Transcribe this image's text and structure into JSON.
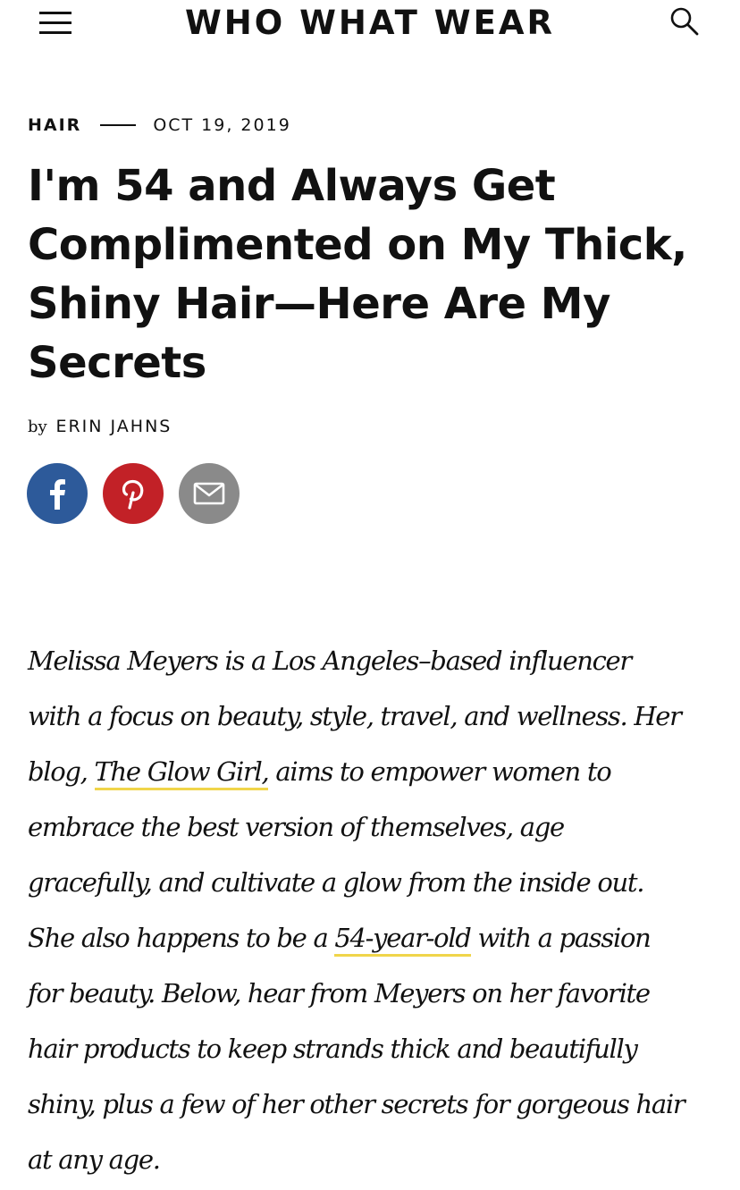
{
  "header": {
    "logo": "WHO WHAT WEAR",
    "menu_icon": "hamburger-menu-icon",
    "search_icon": "search-icon"
  },
  "article": {
    "category": "HAIR",
    "date": "OCT 19, 2019",
    "title": "I'm 54 and Always Get Complimented on My Thick, Shiny Hair—Here Are My Secrets",
    "byline_prefix": "by",
    "author": "ERIN JAHNS"
  },
  "share": {
    "facebook_icon": "facebook-icon",
    "pinterest_icon": "pinterest-icon",
    "email_icon": "email-icon",
    "colors": {
      "facebook": "#2d5a9a",
      "pinterest": "#c22127",
      "email": "#8a8a8a"
    }
  },
  "body": {
    "p1_part1": "Melissa Meyers is a Los Angeles–based influencer with a focus on beauty, style, travel, and wellness. Her blog, ",
    "p1_link1": "The Glow Girl,",
    "p1_part2": " aims to empower women to embrace the best version of themselves, age gracefully, and cultivate a glow from the inside out. She also happens to be a ",
    "p1_link2": "54-year-old",
    "p1_part3": " with a passion for beauty. Below, hear from Meyers on her favorite hair products to keep strands thick and beautifully shiny, plus a few of her other secrets for gorgeous hair at any age."
  },
  "colors": {
    "link_underline": "#f0d54a",
    "text": "#111111"
  }
}
